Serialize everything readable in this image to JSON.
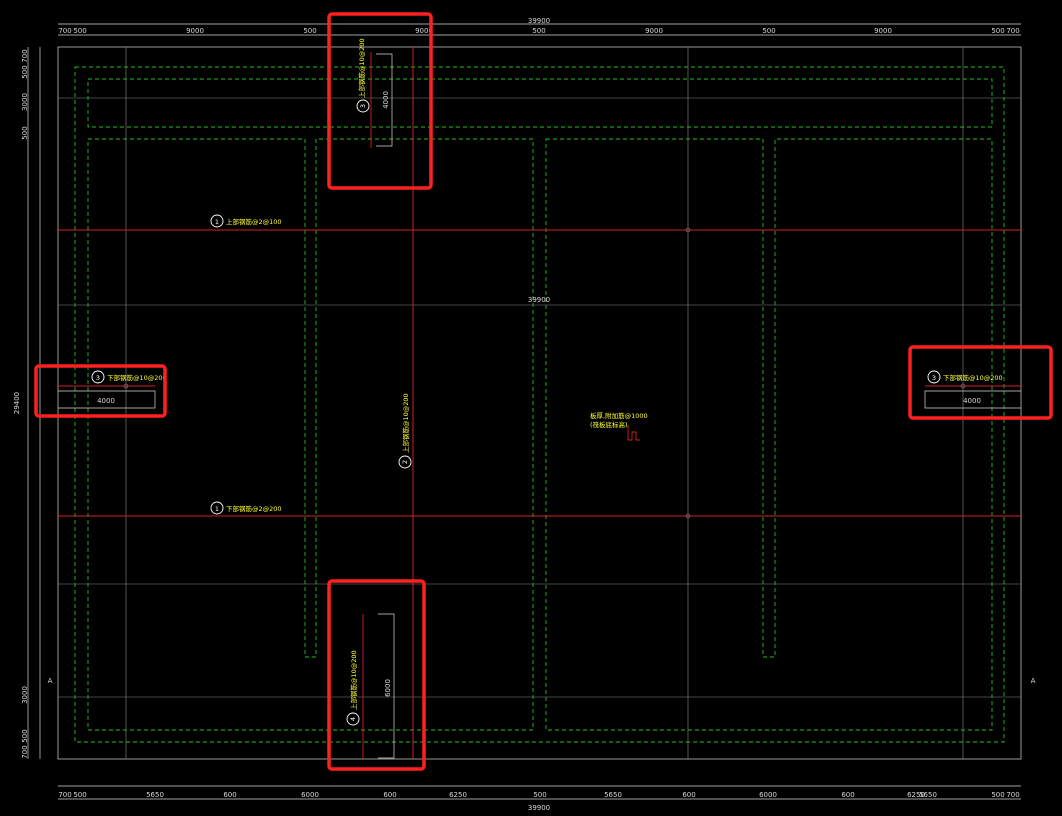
{
  "drawing": {
    "top_dims": [
      "700",
      "500",
      "9000",
      "500",
      "9000",
      "500",
      "9000",
      "500",
      "9000",
      "500",
      "700"
    ],
    "top_total": "39900",
    "bottom_dims": [
      "700",
      "500",
      "5650",
      "600",
      "6000",
      "600",
      "6250",
      "500",
      "5650",
      "600",
      "6000",
      "600",
      "6250",
      "5650",
      "500",
      "700"
    ],
    "bottom_total": "39900",
    "middle_total": "39900",
    "left_dims": [
      "700",
      "500",
      "3000",
      "500",
      "3000",
      "500",
      "700"
    ],
    "left_total": "29400",
    "section_mark": "A",
    "ref_block_label": "4000",
    "ref_block_label_right": "4000",
    "top_vertical_dim": "4000",
    "bottom_vertical_dim": "6000",
    "center_note_line1": "板厚,附加筋@1000",
    "center_note_line2": "(筏板底标高)",
    "labels": {
      "top_strip": {
        "num": "1",
        "text": "上部钢筋@2@100"
      },
      "bottom_strip": {
        "num": "1",
        "text": "下部钢筋@2@200"
      },
      "left_rebar": {
        "num": "3",
        "text": "下部钢筋@10@200"
      },
      "right_rebar": {
        "num": "3",
        "text": "下部钢筋@10@200"
      },
      "center_vertical": {
        "num": "2",
        "text": "上部钢筋@10@200"
      },
      "top_vertical": {
        "num": "3",
        "text": "上部钢筋@10@200"
      },
      "bottom_vertical": {
        "num": "4",
        "text": "上部钢筋@10@200"
      }
    }
  },
  "colors": {
    "background": "#000000",
    "outline": "#d8d8d8",
    "grid": "#8a8a8a",
    "rebar_red": "#d42020",
    "dashed_green": "#22c022",
    "label_yellow": "#ffff33",
    "highlight": "#ff2020"
  }
}
